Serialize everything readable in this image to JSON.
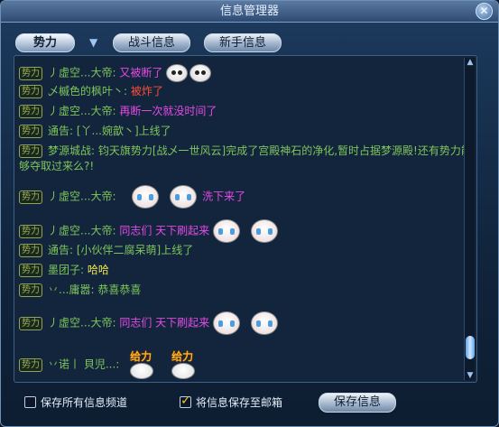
{
  "window": {
    "title": "信息管理器"
  },
  "tabs": [
    {
      "label": "势力"
    },
    {
      "label": "战斗信息"
    },
    {
      "label": "新手信息"
    }
  ],
  "channel_tag": "势力",
  "messages": [
    {
      "sender": "丿虚空...大帝:",
      "text": "又被断了",
      "color": "magenta"
    },
    {
      "sender": "乄槭色的枫叶丶:",
      "text": "被炸了",
      "color": "red"
    },
    {
      "sender": "丿虚空...大帝:",
      "text": "再断一次就没时间了",
      "color": "magenta"
    },
    {
      "sender": "通告:",
      "text": "[丫...婉歆丶]上线了",
      "color": "green"
    },
    {
      "sender": "梦源城战:",
      "text": "钧天旗势力[战乄一世风云]完成了宫殿神石的净化,暂时占据梦源殿!还有势力能够夺取过来么?!",
      "color": "green"
    },
    {
      "sender": "丿虚空...大帝:",
      "text": "洗下来了",
      "color": "magenta"
    },
    {
      "sender": "丿虚空...大帝:",
      "text": "同志们 天下刷起来",
      "color": "magenta"
    },
    {
      "sender": "通告:",
      "text": "[小伙伴二腐呆萌]上线了",
      "color": "green"
    },
    {
      "sender": "墨团子:",
      "text": "哈哈",
      "color": "yellow"
    },
    {
      "sender": "丷...庸嚣:",
      "text": "恭喜恭喜",
      "color": "green"
    },
    {
      "sender": "丿虚空...大帝:",
      "text": "同志们 天下刷起来",
      "color": "magenta"
    },
    {
      "sender": "丷诺丨 貝児...:",
      "text": "",
      "color": "green"
    }
  ],
  "emoji_text": "给力",
  "footer": {
    "save_all_label": "保存所有信息频道",
    "save_all_checked": false,
    "save_mail_label": "将信息保存至邮箱",
    "save_mail_checked": true,
    "save_button_label": "保存信息"
  },
  "colors": {
    "magenta": "#e44ae4",
    "red": "#ff4d35",
    "green": "#7fc55b",
    "yellow": "#f0e64a"
  }
}
